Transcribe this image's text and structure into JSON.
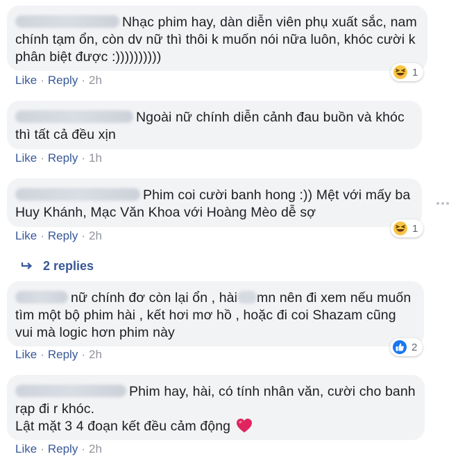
{
  "comments": [
    {
      "text_line1": "Nhạc phim hay, dàn diễn viên phụ xuất sắc, nam",
      "text_line2": "chính tạm ổn, còn dv nữ thì thôi k muốn nói nữa luôn, khóc cười k",
      "text_line3": "phân biệt được :))))))))))",
      "like_label": "Like",
      "reply_label": "Reply",
      "time": "2h",
      "reaction": {
        "icon": "haha-emoji-icon",
        "count": "1"
      }
    },
    {
      "text_line1": "Ngoài nữ chính diễn cảnh đau buồn và khóc",
      "text_line2": "thì tất cả đều xịn",
      "like_label": "Like",
      "reply_label": "Reply",
      "time": "1h"
    },
    {
      "text_line1": "Phim coi cười banh hong :)) Mệt với mấy ba",
      "text_line2": "Huy Khánh, Mạc Văn Khoa với Hoàng Mèo dễ sợ",
      "like_label": "Like",
      "reply_label": "Reply",
      "time": "2h",
      "reaction": {
        "icon": "haha-emoji-icon",
        "count": "1"
      },
      "replies_label": "2 replies"
    },
    {
      "text_line1a": "nữ chính đơ còn lại ổn , hài",
      "text_line1b": "mn nên đi xem nếu muốn",
      "text_line2": "tìm một bộ phim hài , kết hơi mơ hồ , hoặc đi coi Shazam cũng",
      "text_line3": "vui mà logic hơn phim này",
      "like_label": "Like",
      "reply_label": "Reply",
      "time": "2h",
      "reaction": {
        "icon": "like-thumb-icon",
        "count": "2"
      }
    },
    {
      "text_line1": "Phim hay, hài, có tính nhân văn, cười cho banh",
      "text_line2": "rạp đi r khóc.",
      "text_line3": "Lật mặt 3 4 đoạn kết đều cảm động",
      "like_label": "Like",
      "reply_label": "Reply",
      "time": "2h"
    }
  ],
  "colors": {
    "bubble": "#f2f3f5",
    "link": "#385898",
    "meta": "#90949c",
    "like_blue": "#1877f2",
    "haha_yellow": "#f7c544",
    "heart_red": "#e0245e"
  }
}
